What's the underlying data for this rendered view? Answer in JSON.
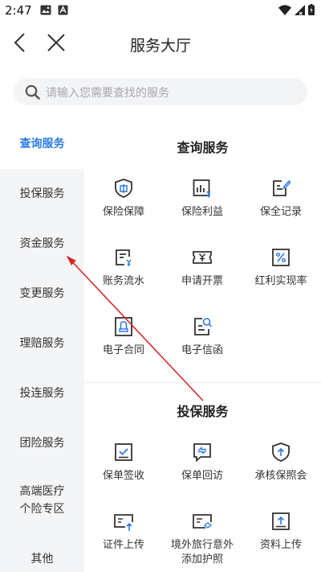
{
  "status_bar": {
    "time": "2:47"
  },
  "header": {
    "title": "服务大厅"
  },
  "search": {
    "placeholder": "请输入您需要查找的服务"
  },
  "sidebar": {
    "items": [
      {
        "label": "查询服务",
        "active": true
      },
      {
        "label": "投保服务"
      },
      {
        "label": "资金服务"
      },
      {
        "label": "变更服务"
      },
      {
        "label": "理赔服务"
      },
      {
        "label": "投连服务"
      },
      {
        "label": "团险服务"
      },
      {
        "label": "高端医疗个险专区",
        "line1": "高端医疗",
        "line2": "个险专区"
      },
      {
        "label": "其他"
      }
    ]
  },
  "sections": [
    {
      "title": "查询服务",
      "items": [
        {
          "label": "保险保障",
          "icon": "shield-icon"
        },
        {
          "label": "保险利益",
          "icon": "benefit-chart-icon"
        },
        {
          "label": "保全记录",
          "icon": "record-edit-icon"
        },
        {
          "label": "账务流水",
          "icon": "statement-icon"
        },
        {
          "label": "申请开票",
          "icon": "invoice-icon"
        },
        {
          "label": "红利实现率",
          "icon": "percent-icon"
        },
        {
          "label": "电子合同",
          "icon": "contract-icon"
        },
        {
          "label": "电子信函",
          "icon": "letter-search-icon"
        }
      ]
    },
    {
      "title": "投保服务",
      "items": [
        {
          "label": "保单签收",
          "icon": "checkbox-icon"
        },
        {
          "label": "保单回访",
          "icon": "callback-icon"
        },
        {
          "label": "承核保照会",
          "icon": "upload-shield-icon"
        },
        {
          "label": "证件上传",
          "icon": "id-upload-icon"
        },
        {
          "label": "境外旅行意外添加护照",
          "line1": "境外旅行意外",
          "line2": "添加护照",
          "icon": "passport-icon"
        },
        {
          "label": "资料上传",
          "icon": "file-upload-icon"
        }
      ]
    }
  ],
  "colors": {
    "accent": "#2c7be5",
    "sidebar_bg": "#f4f5f7",
    "annotation": "#d62828"
  }
}
